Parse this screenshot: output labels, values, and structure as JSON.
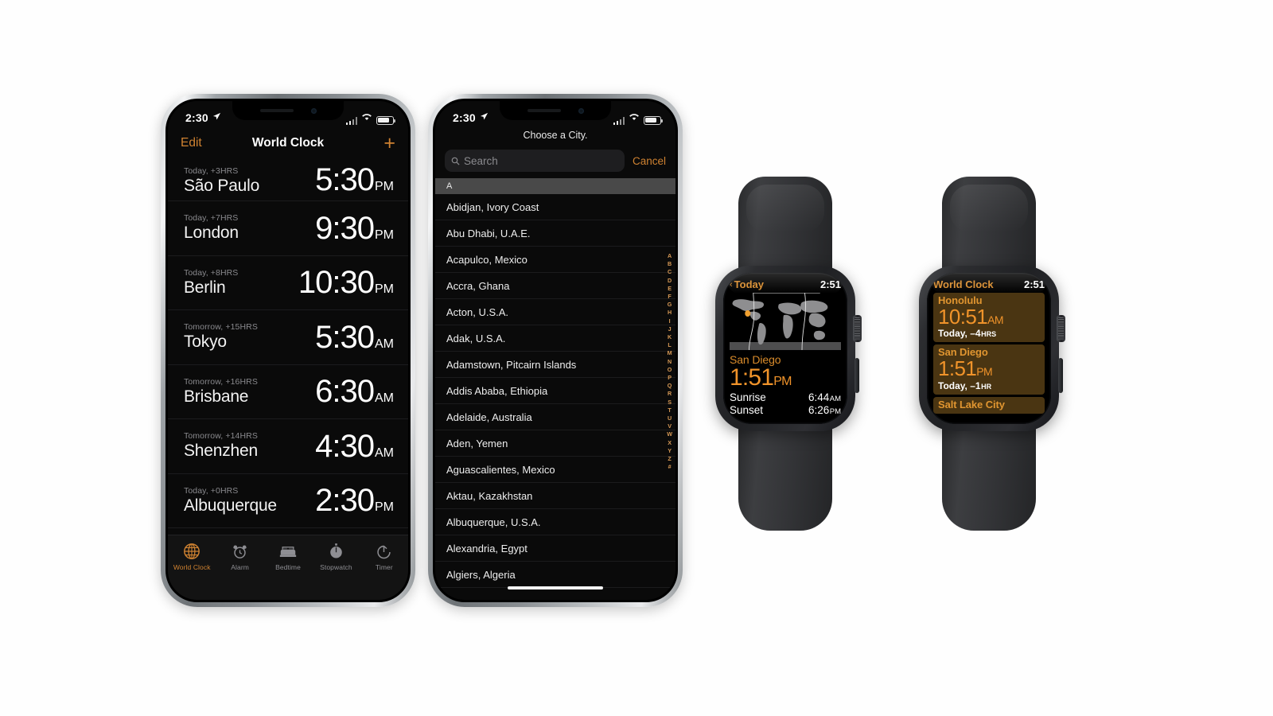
{
  "page": {
    "background": "#fdfdfd",
    "accent_orange": "#cf8231",
    "watch_orange": "#f0932a"
  },
  "phone1": {
    "status": {
      "time": "2:30",
      "location_icon": "location-arrow-icon",
      "signal_icon": "cellular-bars-icon",
      "wifi_icon": "wifi-icon",
      "battery_icon": "battery-icon"
    },
    "nav": {
      "edit_label": "Edit",
      "title": "World Clock",
      "add_label": "+"
    },
    "clocks": [
      {
        "meta": "Today, +3HRS",
        "city": "São Paulo",
        "time": "5:30",
        "ampm": "PM"
      },
      {
        "meta": "Today, +7HRS",
        "city": "London",
        "time": "9:30",
        "ampm": "PM"
      },
      {
        "meta": "Today, +8HRS",
        "city": "Berlin",
        "time": "10:30",
        "ampm": "PM"
      },
      {
        "meta": "Tomorrow, +15HRS",
        "city": "Tokyo",
        "time": "5:30",
        "ampm": "AM"
      },
      {
        "meta": "Tomorrow, +16HRS",
        "city": "Brisbane",
        "time": "6:30",
        "ampm": "AM"
      },
      {
        "meta": "Tomorrow, +14HRS",
        "city": "Shenzhen",
        "time": "4:30",
        "ampm": "AM"
      },
      {
        "meta": "Today, +0HRS",
        "city": "Albuquerque",
        "time": "2:30",
        "ampm": "PM"
      }
    ],
    "tabs": [
      {
        "label": "World Clock",
        "icon": "globe-icon",
        "active": true
      },
      {
        "label": "Alarm",
        "icon": "alarm-clock-icon",
        "active": false
      },
      {
        "label": "Bedtime",
        "icon": "bed-icon",
        "active": false
      },
      {
        "label": "Stopwatch",
        "icon": "stopwatch-icon",
        "active": false
      },
      {
        "label": "Timer",
        "icon": "timer-icon",
        "active": false
      }
    ]
  },
  "phone2": {
    "status": {
      "time": "2:30",
      "location_icon": "location-arrow-icon"
    },
    "title": "Choose a City.",
    "search": {
      "placeholder": "Search",
      "value": "",
      "icon": "search-icon"
    },
    "cancel_label": "Cancel",
    "section_header": "A",
    "cities": [
      "Abidjan, Ivory Coast",
      "Abu Dhabi, U.A.E.",
      "Acapulco, Mexico",
      "Accra, Ghana",
      "Acton, U.S.A.",
      "Adak, U.S.A.",
      "Adamstown, Pitcairn Islands",
      "Addis Ababa, Ethiopia",
      "Adelaide, Australia",
      "Aden, Yemen",
      "Aguascalientes, Mexico",
      "Aktau, Kazakhstan",
      "Albuquerque, U.S.A.",
      "Alexandria, Egypt",
      "Algiers, Algeria"
    ],
    "alpha_index": [
      "A",
      "B",
      "C",
      "D",
      "E",
      "F",
      "G",
      "H",
      "I",
      "J",
      "K",
      "L",
      "M",
      "N",
      "O",
      "P",
      "Q",
      "R",
      "S",
      "T",
      "U",
      "V",
      "W",
      "X",
      "Y",
      "Z",
      "#"
    ]
  },
  "watch1": {
    "header": {
      "back_label": "Today",
      "back_icon": "chevron-left-icon",
      "time": "2:51"
    },
    "map": {
      "icon": "world-map-icon",
      "marker": "location-dot-marker"
    },
    "city": "San Diego",
    "big_time": "1:51",
    "big_ampm": "PM",
    "rows": [
      {
        "label": "Sunrise",
        "value": "6:44",
        "suffix": "AM"
      },
      {
        "label": "Sunset",
        "value": "6:26",
        "suffix": "PM"
      }
    ]
  },
  "watch2": {
    "header": {
      "title": "World Clock",
      "time": "2:51"
    },
    "cards": [
      {
        "city": "Honolulu",
        "time": "10:51",
        "ampm": "AM",
        "meta": "Today, –4",
        "meta_suffix": "HRS",
        "partial": false
      },
      {
        "city": "San Diego",
        "time": "1:51",
        "ampm": "PM",
        "meta": "Today, –1",
        "meta_suffix": "HR",
        "partial": false
      },
      {
        "city": "Salt Lake City",
        "time": "",
        "ampm": "",
        "meta": "",
        "meta_suffix": "",
        "partial": true
      }
    ]
  }
}
